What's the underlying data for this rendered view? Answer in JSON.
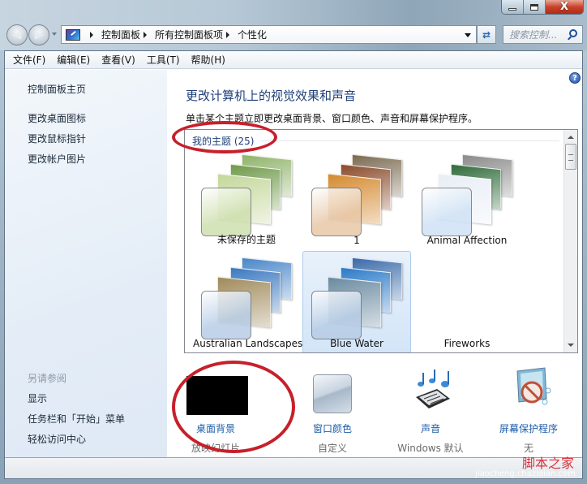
{
  "window": {
    "minimize_icon": "minimize-icon",
    "maximize_icon": "maximize-icon",
    "close_label": "X"
  },
  "navigation": {
    "back_icon": "back-arrow-icon",
    "forward_icon": "forward-arrow-icon",
    "breadcrumb": [
      "控制面板",
      "所有控制面板项",
      "个性化"
    ],
    "refresh_icon": "refresh-icon",
    "search_placeholder": "搜索控制..."
  },
  "menubar": {
    "items": [
      "文件(F)",
      "编辑(E)",
      "查看(V)",
      "工具(T)",
      "帮助(H)"
    ]
  },
  "sidebar": {
    "home_link": "控制面板主页",
    "links": [
      "更改桌面图标",
      "更改鼠标指针",
      "更改帐户图片"
    ],
    "see_also_heading": "另请参阅",
    "see_also_links": [
      "显示",
      "任务栏和「开始」菜单",
      "轻松访问中心"
    ]
  },
  "main": {
    "help_label": "?",
    "title": "更改计算机上的视觉效果和声音",
    "description": "单击某个主题立即更改桌面背景、窗口颜色、声音和屏幕保护程序。",
    "group_header": "我的主题 (25)",
    "themes": [
      {
        "label": "未保存的主题",
        "swatch": "#cfe0b0",
        "colors": [
          "#8fb36a",
          "#6f9a4a",
          "#c4d89a"
        ],
        "selected": false
      },
      {
        "label": "1",
        "swatch": "#e8c8a8",
        "colors": [
          "#7a6a50",
          "#8a4a2a",
          "#d48a30"
        ],
        "selected": false
      },
      {
        "label": "Animal Affection",
        "swatch": "#cfe2f5",
        "colors": [
          "#8a8a8a",
          "#2f6a3a",
          "#e8eef5"
        ],
        "selected": false
      },
      {
        "label": "Australian Landscapes",
        "swatch": "#b7cde6",
        "colors": [
          "#4a86c8",
          "#3a78c0",
          "#a08a5a"
        ],
        "selected": false
      },
      {
        "label": "Blue Water",
        "swatch": "#b7cde6",
        "colors": [
          "#3a6aa8",
          "#2a7ac8",
          "#6a8aa0"
        ],
        "selected": true
      },
      {
        "label": "Fireworks",
        "swatch": null,
        "colors": [],
        "selected": false
      }
    ],
    "settings": [
      {
        "label": "桌面背景",
        "value": "放映幻灯片",
        "icon": "desktop-background-icon"
      },
      {
        "label": "窗口颜色",
        "value": "自定义",
        "icon": "window-color-icon"
      },
      {
        "label": "声音",
        "value": "Windows 默认",
        "icon": "sound-icon"
      },
      {
        "label": "屏幕保护程序",
        "value": "无",
        "icon": "screensaver-icon"
      }
    ]
  },
  "watermark": {
    "text": "脚本之家",
    "sub": "jiaocheng.chazidian.com"
  }
}
